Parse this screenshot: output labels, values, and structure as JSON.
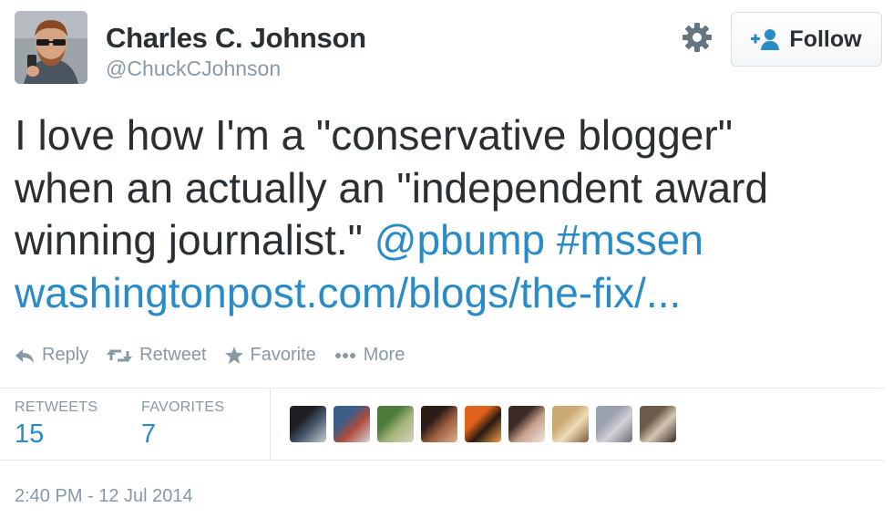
{
  "author": {
    "name": "Charles C. Johnson",
    "handle": "@ChuckCJohnson",
    "avatar_icon": "user-avatar-photo"
  },
  "header_actions": {
    "settings_icon": "gear-icon",
    "follow_label": "Follow",
    "follow_icon": "add-person-icon"
  },
  "tweet": {
    "line1": "I love how I'm a \"conservative blogger\"",
    "line2": "when an actually an \"independent award",
    "line3_text": "winning journalist.\"",
    "mention": "@pbump",
    "hashtag": "#mssen",
    "url": "washingtonpost.com/blogs/the-fix/..."
  },
  "actions": {
    "reply": "Reply",
    "retweet": "Retweet",
    "favorite": "Favorite",
    "more": "More"
  },
  "stats": {
    "retweets_label": "RETWEETS",
    "retweets_count": "15",
    "favorites_label": "FAVORITES",
    "favorites_count": "7"
  },
  "favoriters": [
    {
      "colors": [
        "#1d1f24",
        "#4a5a6e",
        "#c8ccd2"
      ]
    },
    {
      "colors": [
        "#3c5d86",
        "#b24a3a",
        "#cfd6de"
      ]
    },
    {
      "colors": [
        "#4e7a3e",
        "#a6b57a",
        "#d8d2c0"
      ]
    },
    {
      "colors": [
        "#2a1d18",
        "#9b5c3d",
        "#e0b08c"
      ]
    },
    {
      "colors": [
        "#e0621c",
        "#2a1a12",
        "#f3a04a"
      ]
    },
    {
      "colors": [
        "#3b2a26",
        "#c7a08a",
        "#efe6de"
      ]
    },
    {
      "colors": [
        "#c9a872",
        "#f0dcb8",
        "#7a5a3c"
      ]
    },
    {
      "colors": [
        "#9aa0ae",
        "#d4d0d6",
        "#6a6c7a"
      ]
    },
    {
      "colors": [
        "#6d5a4a",
        "#d8c6b4",
        "#3a2c22"
      ]
    }
  ],
  "timestamp": "2:40 PM - 12 Jul 2014"
}
